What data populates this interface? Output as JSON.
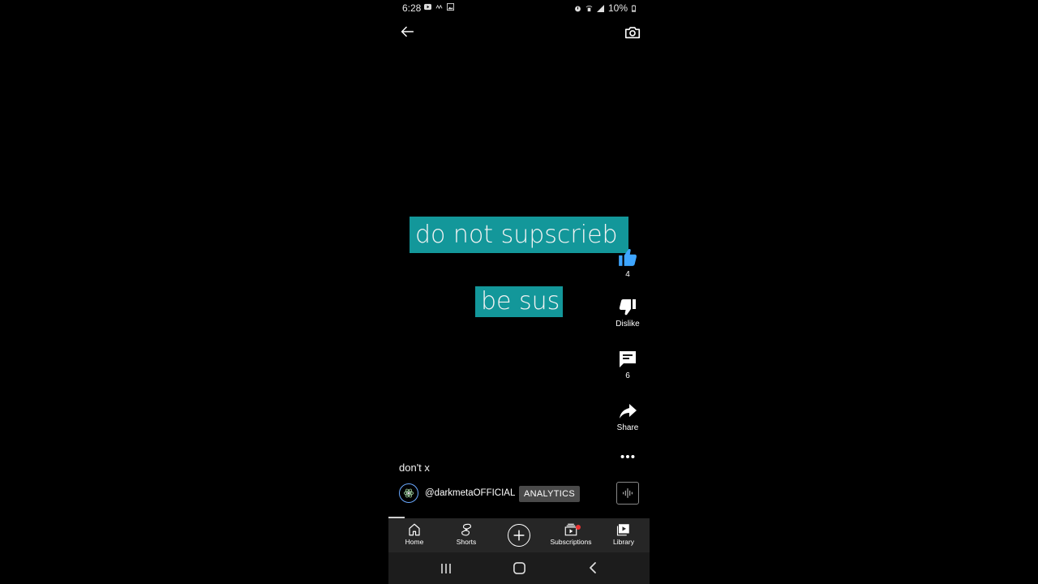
{
  "status_bar": {
    "time": "6:28",
    "battery": "10%"
  },
  "captions": {
    "line1": "do not supscrieb",
    "line2": "be sus"
  },
  "actions": {
    "like_count": "4",
    "dislike_label": "Dislike",
    "comment_count": "6",
    "share_label": "Share"
  },
  "video": {
    "title": "don't x",
    "channel": "@darkmetaOFFICIAL",
    "analytics_label": "ANALYTICS"
  },
  "bottom_nav": {
    "home": "Home",
    "shorts": "Shorts",
    "subscriptions": "Subscriptions",
    "library": "Library"
  },
  "colors": {
    "caption_bg": "#13979a",
    "like_active": "#3ea6ff",
    "nav_bg": "#262626"
  }
}
